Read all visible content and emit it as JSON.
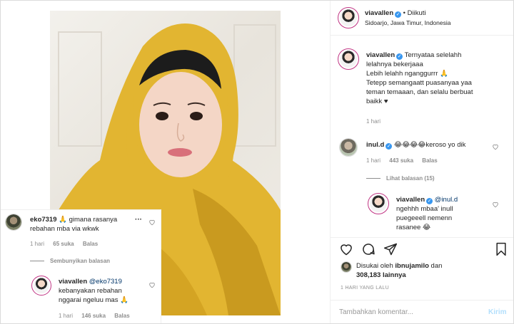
{
  "header": {
    "username": "viavallen",
    "follow_status": "• Diikuti",
    "location": "Sidoarjo, Jawa Timur, Indonesia"
  },
  "caption": {
    "username": "viavallen",
    "lines": [
      "Ternyataa selelahh",
      "lelahnya bekerjaaa",
      "Lebih lelahh nganggurrr 🙏",
      "Tetepp semangaatt puasanyaa yaa",
      "teman temaaan, dan selalu berbuat",
      "baikk ♥"
    ],
    "time": "1 hari"
  },
  "comments": [
    {
      "username": "inul.d",
      "text": "😂😂😂😂keroso yo dik",
      "time": "1 hari",
      "likes": "443 suka",
      "reply": "Balas",
      "view_replies": "Lihat balasan (15)"
    },
    {
      "username": "viavallen",
      "mention": "@inul.d",
      "lines": [
        "ngehhh mbaa' inull",
        "puegeeell nemenn",
        "rasanee 😂"
      ]
    }
  ],
  "actions": {
    "like_icon": "heart-icon",
    "comment_icon": "comment-icon",
    "share_icon": "share-icon",
    "save_icon": "bookmark-icon"
  },
  "likes": {
    "prefix": "Disukai oleh",
    "user": "ibnujamilo",
    "conj": "dan",
    "count": "308,183",
    "suffix": "lainnya"
  },
  "post_time": "1 HARI YANG LALU",
  "add_comment": {
    "placeholder": "Tambahkan komentar...",
    "post_label": "Kirim"
  },
  "overlay": {
    "comment": {
      "username": "eko7319",
      "lines": [
        "🙏 gimana rasanya",
        "rebahan mba via wkwk"
      ],
      "time": "1 hari",
      "likes": "65 suka",
      "reply": "Balas",
      "more": "···"
    },
    "hide_replies": "Sembunyikan balasan",
    "reply": {
      "username": "viavallen",
      "mention": "@eko7319",
      "lines": [
        "kebanyakan rebahan",
        "nggarai ngeluu mas 🙏"
      ],
      "time": "1 hari",
      "likes": "146 suka",
      "reply": "Balas"
    }
  }
}
